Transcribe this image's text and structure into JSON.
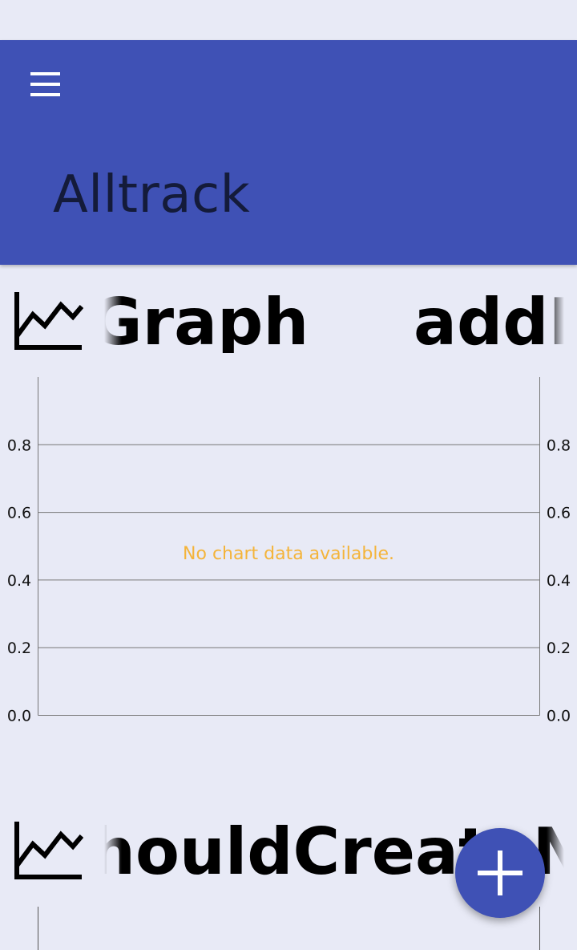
{
  "app": {
    "title": "Alltrack"
  },
  "icons": {
    "menu": "menu-icon",
    "card": "line-chart-icon",
    "fab": "add-icon"
  },
  "cards": [
    {
      "header_text": "Graph addN",
      "header_fragments": [
        "Graph",
        "addN"
      ]
    },
    {
      "header_text": "houldCreateNewG",
      "header_fragments": [
        "houldCreateNewG"
      ]
    }
  ],
  "chart": {
    "empty_message": "No chart data available.",
    "y_ticks_left": [
      "0.0",
      "0.2",
      "0.4",
      "0.6",
      "0.8"
    ],
    "y_ticks_right": [
      "0.0",
      "0.2",
      "0.4",
      "0.6",
      "0.8"
    ],
    "ylim": [
      0,
      1.0
    ]
  },
  "colors": {
    "primary": "#3f51b5",
    "background": "#e8eaf6",
    "empty_message": "#f4b43a"
  }
}
